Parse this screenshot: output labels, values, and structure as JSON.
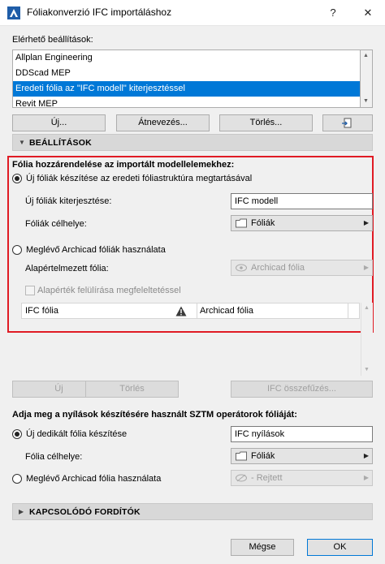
{
  "window": {
    "title": "Fóliakonverzió IFC importáláshoz",
    "help_label": "?",
    "close_label": "✕"
  },
  "presets": {
    "label": "Elérhető beállítások:",
    "items": [
      "Allplan Engineering",
      "DDScad MEP",
      "Eredeti fólia az \"IFC modell\" kiterjesztéssel",
      "Revit MEP"
    ],
    "selected_index": 2
  },
  "preset_buttons": {
    "new": "Új...",
    "rename": "Átnevezés...",
    "delete": "Törlés..."
  },
  "settings_section": {
    "title": "BEÁLLÍTÁSOK",
    "assign_heading": "Fólia hozzárendelése az importált modellelemekhez:",
    "option_new": "Új fóliák készítése az eredeti fóliastruktúra megtartásával",
    "extension_label": "Új fóliák kiterjesztése:",
    "extension_value": "IFC modell",
    "target_label": "Fóliák célhelye:",
    "target_value": "Fóliák",
    "option_existing": "Meglévő Archicad fóliák használata",
    "default_layer_label": "Alapértelmezett fólia:",
    "default_layer_value": "Archicad fólia",
    "overwrite_label": "Alapérték felülírása megfeleltetéssel",
    "table": {
      "left": "IFC fólia",
      "right": "Archicad fólia"
    }
  },
  "mapping_buttons": {
    "new": "Új",
    "delete": "Törlés",
    "merge": "IFC összefűzés..."
  },
  "openings": {
    "heading": "Adja meg a nyílások készítésére használt SZTM operátorok fóliáját:",
    "option_new": "Új dedikált fólia készítése",
    "new_value": "IFC nyílások",
    "target_label": "Fólia célhelye:",
    "target_value": "Fóliák",
    "option_existing": "Meglévő Archicad fólia használata",
    "existing_value": "- Rejtett"
  },
  "related_section": {
    "title": "KAPCSOLÓDÓ FORDÍTÓK"
  },
  "footer": {
    "cancel": "Mégse",
    "ok": "OK"
  },
  "colors": {
    "selection": "#0078d7",
    "highlight_border": "#e01b24"
  }
}
